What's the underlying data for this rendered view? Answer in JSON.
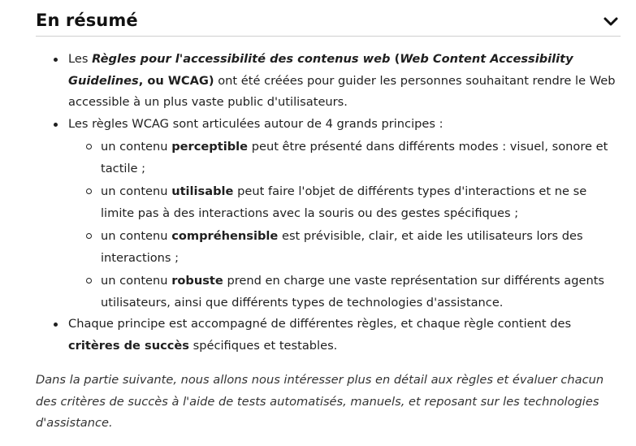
{
  "section": {
    "title": "En résumé",
    "toggle_icon": "chevron-down-icon"
  },
  "bullets": {
    "item1": {
      "pre": "Les ",
      "title_italic": "Règles pour l'accessibilité des contenus web",
      "paren_open": " (",
      "title_en_italic": "Web Content Accessibility Guidelines",
      "acronym": ", ou WCAG)",
      "post": " ont été créées pour guider les personnes souhaitant rendre le Web accessible à un plus vaste public d'utilisateurs."
    },
    "item2": {
      "text": "Les règles WCAG sont articulées autour de 4 grands principes :",
      "principles": [
        {
          "pre": "un contenu ",
          "term": "perceptible",
          "post": " peut être présenté dans différents modes : visuel, sonore et tactile ;"
        },
        {
          "pre": "un contenu ",
          "term": "utilisable",
          "post": " peut faire l'objet de différents types d'interactions et ne se limite pas à des interactions avec la souris ou des gestes spécifiques ;"
        },
        {
          "pre": "un contenu ",
          "term": "compréhensible",
          "post": " est prévisible, clair, et aide les utilisateurs lors des interactions ;"
        },
        {
          "pre": "un contenu ",
          "term": "robuste",
          "post": " prend en charge une vaste représentation sur différents agents utilisateurs, ainsi que différents types de technologies d'assistance."
        }
      ]
    },
    "item3": {
      "pre": "Chaque principe est accompagné de différentes règles, et chaque règle contient des ",
      "term": "critères de succès",
      "post": " spécifiques et testables."
    }
  },
  "closing": "Dans la partie suivante, nous allons nous intéresser plus en détail aux règles et évaluer chacun des critères de succès à l'aide de tests automatisés, manuels, et reposant sur les technologies d'assistance."
}
